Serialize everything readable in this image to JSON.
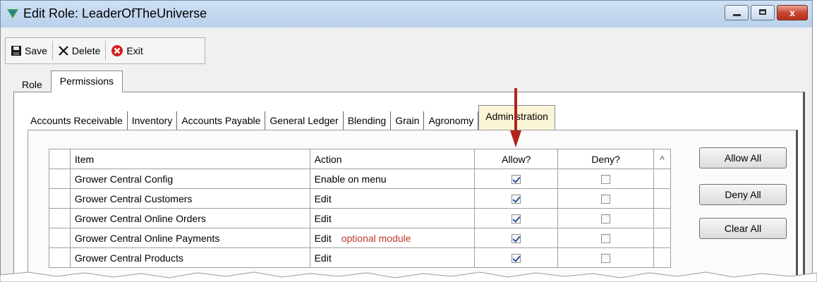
{
  "window": {
    "title": "Edit Role: LeaderOfTheUniverse",
    "close_glyph": "x"
  },
  "toolbar": {
    "save": "Save",
    "delete": "Delete",
    "exit": "Exit"
  },
  "outer_tabs": [
    "Role",
    "Permissions"
  ],
  "inner_tabs": [
    "Accounts Receivable",
    "Inventory",
    "Accounts Payable",
    "General Ledger",
    "Blending",
    "Grain",
    "Agronomy",
    "Administration"
  ],
  "grid": {
    "headers": {
      "item": "Item",
      "action": "Action",
      "allow": "Allow?",
      "deny": "Deny?",
      "scroll": "^"
    },
    "rows": [
      {
        "item": "Grower Central Config",
        "action": "Enable on menu",
        "note": "",
        "allow": true,
        "deny": false
      },
      {
        "item": "Grower Central Customers",
        "action": "Edit",
        "note": "",
        "allow": true,
        "deny": false
      },
      {
        "item": "Grower Central Online Orders",
        "action": "Edit",
        "note": "",
        "allow": true,
        "deny": false
      },
      {
        "item": "Grower Central Online Payments",
        "action": "Edit",
        "note": "optional module",
        "allow": true,
        "deny": false
      },
      {
        "item": "Grower Central Products",
        "action": "Edit",
        "note": "",
        "allow": true,
        "deny": false
      }
    ]
  },
  "buttons": {
    "allow_all": "Allow All",
    "deny_all": "Deny All",
    "clear_all": "Clear All"
  },
  "annotation": {
    "arrow_color": "#b0241b",
    "note_color": "#c0392b"
  }
}
